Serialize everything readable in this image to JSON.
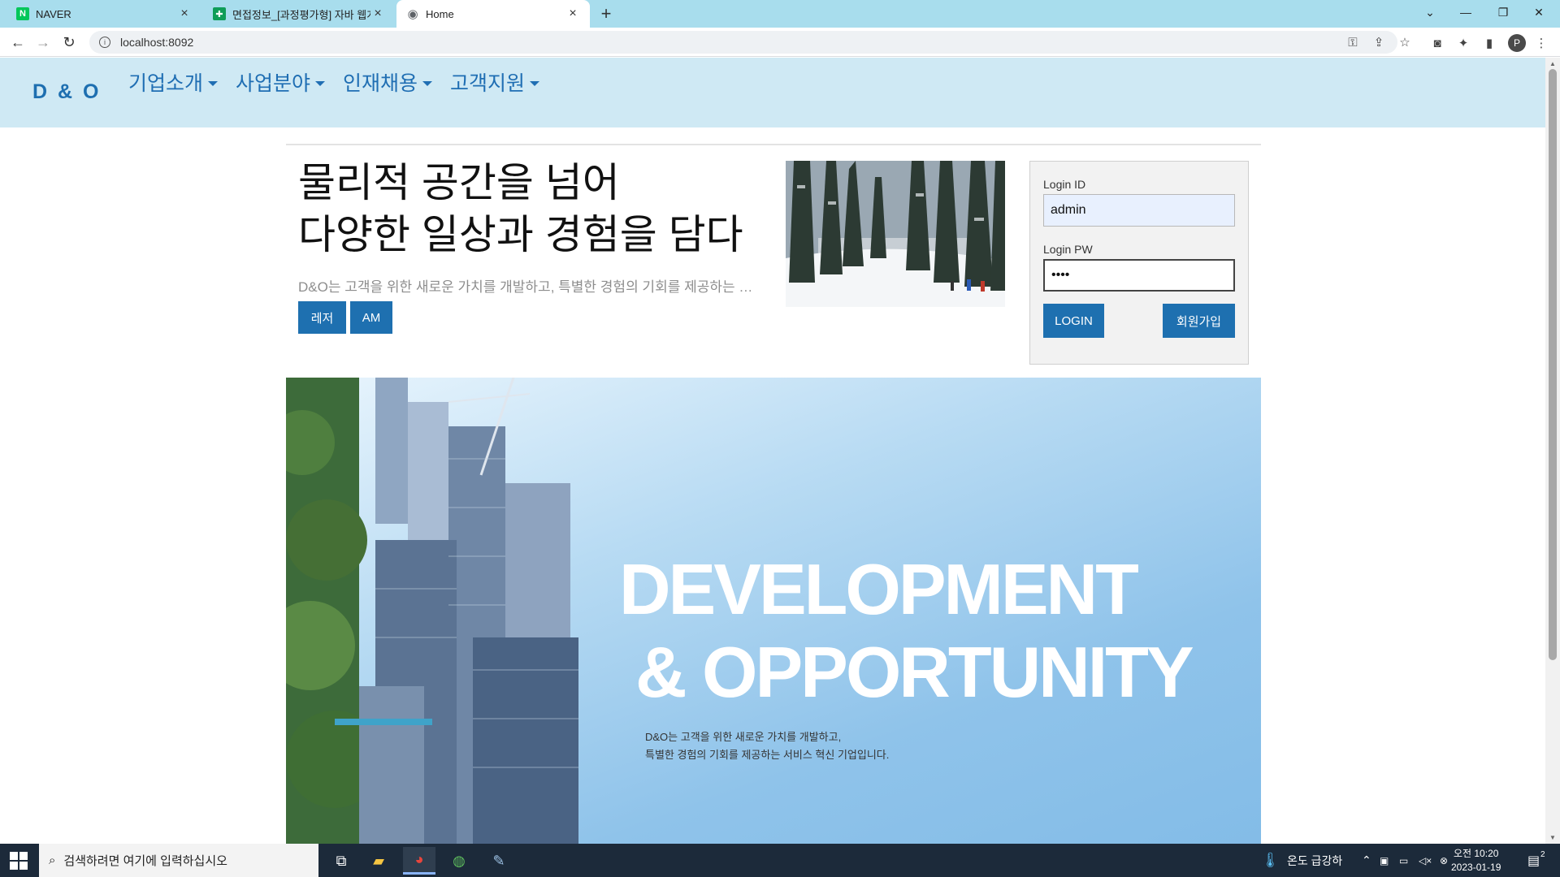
{
  "browser": {
    "tabs": [
      {
        "title": "NAVER",
        "icon": "naver-icon",
        "icon_letter": "N",
        "icon_color": "#03c75a"
      },
      {
        "title": "면접정보_[과정평가형] 자바 웹개발",
        "icon": "sheets-icon",
        "icon_letter": "✚",
        "icon_color": "#0f9d58"
      },
      {
        "title": "Home",
        "icon": "globe-icon",
        "icon_letter": "◉",
        "icon_color": "#5f6368"
      }
    ],
    "new_tab": "+",
    "url": "localhost:8092",
    "profile_initial": "P",
    "window_controls": {
      "dropdown": "⌄",
      "minimize": "—",
      "restore": "❐",
      "close": "✕"
    }
  },
  "site": {
    "brand": "D & O",
    "menu": [
      "기업소개",
      "사업분야",
      "인재채용",
      "고객지원"
    ],
    "headline_line1": "물리적 공간을 넘어",
    "headline_line2": "다양한 일상과 경험을 담다",
    "lead": "D&O는 고객을 위한 새로운 가치를 개발하고, 특별한 경험의 기회를 제공하는 서비스 혁신 기업입니다.",
    "buttons": [
      "레저",
      "AM"
    ],
    "login": {
      "id_label": "Login ID",
      "id_value": "admin",
      "pw_label": "Login PW",
      "pw_value": "••••",
      "login_button": "LOGIN",
      "signup_button": "회원가입"
    },
    "banner": {
      "title_line1": "DEVELOPMENT",
      "title_line2": "& OPPORTUNITY",
      "text_line1": "D&O는 고객을 위한 새로운 가치를 개발하고,",
      "text_line2": "특별한 경험의 기회를 제공하는 서비스 혁신 기업입니다."
    }
  },
  "taskbar": {
    "search_placeholder": "검색하려면 여기에 입력하십시오",
    "weather": "온도 급강하",
    "time": "오전 10:20",
    "date": "2023-01-19",
    "notification_count": "2"
  }
}
